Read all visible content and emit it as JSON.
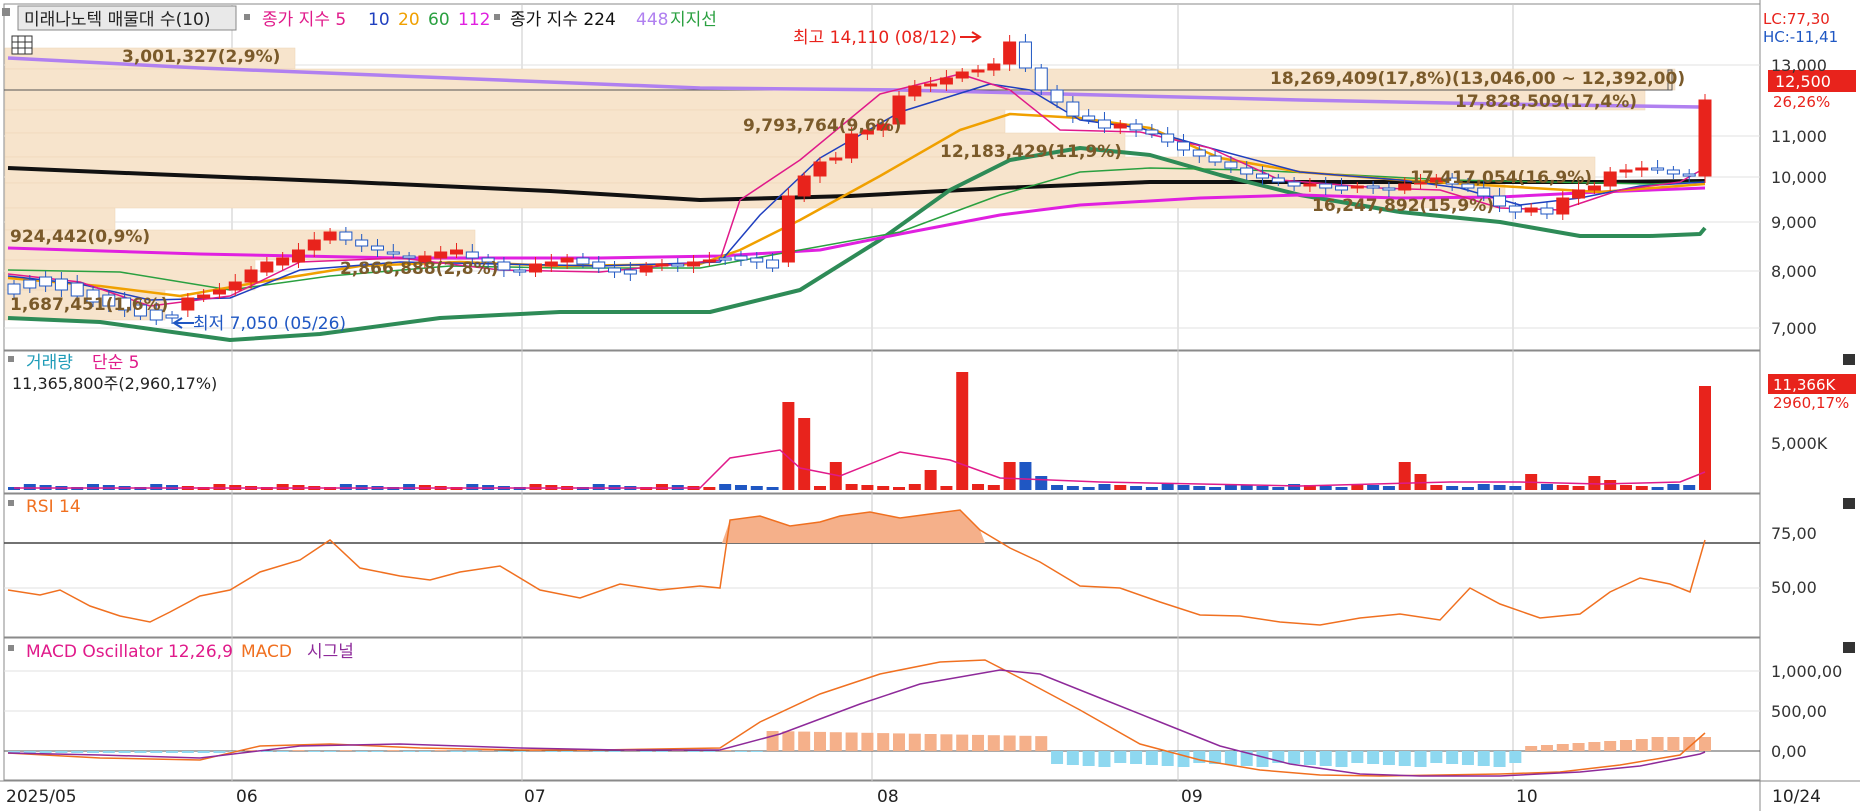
{
  "window": {
    "title": "미래나노텍 매물대 수(10)"
  },
  "price_legend": [
    {
      "text": "종가 지수 5",
      "color": "#e01a8a"
    },
    {
      "text": "10",
      "color": "#1f3fbf"
    },
    {
      "text": "20",
      "color": "#f0a000"
    },
    {
      "text": "60",
      "color": "#2aa040"
    },
    {
      "text": "112",
      "color": "#e020e0"
    },
    {
      "text": "종가 지수 224",
      "color": "#111111"
    },
    {
      "text": "448",
      "color": "#b080f0"
    },
    {
      "text": "지지선",
      "color": "#2aa040"
    }
  ],
  "price_right": {
    "lc": "LC:77,30",
    "hc": "HC:-11,41",
    "current": "12,500",
    "pct": "26,26%"
  },
  "price_ticks": [
    "13,000",
    "12,000",
    "11,000",
    "10,000",
    "9,000",
    "8,000",
    "7,000"
  ],
  "price_annotations": {
    "high": "최고 14,110 (08/12)",
    "low": "최저 7,050 (05/26)",
    "vp1": "3,001,327(2,9%)",
    "vp2": "18,269,409(17,8%)(13,046,00 ~ 12,392,00)",
    "vp3": "17,828,509(17,4%)",
    "vp4": "9,793,764(9,6%)",
    "vp5": "12,183,429(11,9%)",
    "vp6": "17,417,054(16,9%)",
    "vp7": "16,247,892(15,9%)",
    "vp8": "924,442(0,9%)",
    "vp9": "2,866,888(2,8%)",
    "vp10": "1,687,451(1,6%)"
  },
  "volume": {
    "legend1": "거래량",
    "legend2": "단순 5",
    "info": "11,365,800주(2,960,17%)",
    "tick": "5,000K",
    "current": "11,366K",
    "current_pct": "2960,17%"
  },
  "rsi": {
    "legend": "RSI 14",
    "ticks": [
      "75,00",
      "50,00"
    ]
  },
  "macd": {
    "legend1": "MACD Oscillator 12,26,9",
    "legend2": "MACD",
    "legend3": "시그널",
    "ticks": [
      "1,000,00",
      "500,00",
      "0,00"
    ]
  },
  "x_axis": {
    "labels": [
      "2025/05",
      "06",
      "07",
      "08",
      "09",
      "10"
    ],
    "end_label": "10/24"
  },
  "colors": {
    "up": "#e8231c",
    "down": "#1f57c3",
    "vp_fill": "#f7e4cc"
  },
  "chart_data": {
    "type": "candlestick",
    "title": "미래나노텍",
    "x_range": [
      "2025/05",
      "10/24"
    ],
    "price_ylim": [
      6500,
      14500
    ],
    "close_key_points": [
      {
        "date": "05/26",
        "low": 7050
      },
      {
        "date": "08/12",
        "high": 14110
      },
      {
        "date": "10/24",
        "close": 12500
      }
    ],
    "volume_last": "11,366K",
    "rsi_last_approx": 73,
    "macd_ylim": [
      -300,
      1300
    ]
  }
}
